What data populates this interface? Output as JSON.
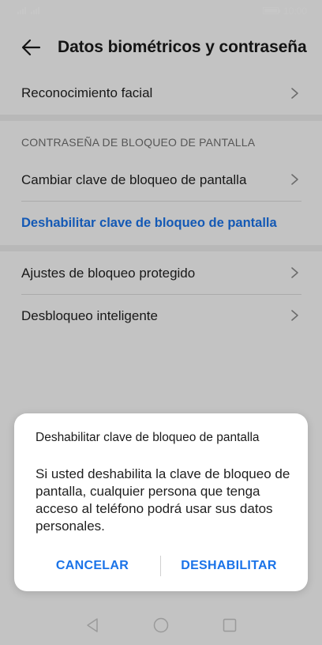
{
  "status_bar": {
    "time": "10:00",
    "icons": [
      "signal-icon",
      "signal-icon",
      "battery-icon"
    ]
  },
  "header": {
    "title": "Datos biométricos y contraseña",
    "back_icon": "arrow-left-icon"
  },
  "settings": {
    "face_recognition": "Reconocimiento facial",
    "section_header": "CONTRASEÑA DE BLOQUEO DE PANTALLA",
    "change_lock": "Cambiar clave de bloqueo de pantalla",
    "disable_lock": "Deshabilitar clave de bloqueo de pantalla",
    "secure_lock": "Ajustes de bloqueo protegido",
    "smart_unlock": "Desbloqueo inteligente"
  },
  "dialog": {
    "title": "Deshabilitar clave de bloqueo de pantalla",
    "message": "Si usted deshabilita la clave de bloqueo de pantalla, cualquier persona que tenga acceso al teléfono podrá usar sus datos personales.",
    "cancel_label": "CANCELAR",
    "confirm_label": "DESHABILITAR"
  },
  "nav_bar": {
    "icons": [
      "triangle-back-icon",
      "circle-home-icon",
      "square-recents-icon"
    ]
  },
  "colors": {
    "accent": "#1a73e8",
    "background": "#fafafa",
    "dialog": "#ffffff"
  }
}
